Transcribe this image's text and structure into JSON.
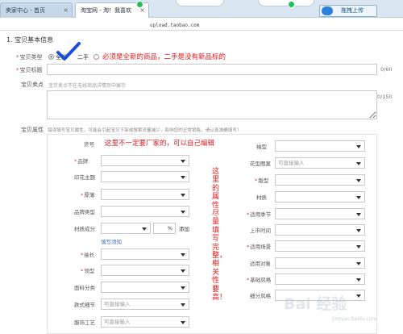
{
  "browser": {
    "tab1": "卖家中心 - 首页",
    "tab2": "淘宝网 - 淘！我喜欢",
    "tab_close": "×",
    "upload_button": "拖拽上传",
    "url": "upload.taobao.com"
  },
  "form": {
    "section_title": "1. 宝贝基本信息",
    "type_label": "宝贝类型",
    "type_options": [
      "全新",
      "二手"
    ],
    "type_selected": "全新",
    "title_label": "宝贝标题",
    "title_value": "",
    "title_counter": "0/60",
    "sellpoint_label": "宝贝卖点",
    "sellpoint_placeholder": "宝贝卖点不在无线商品详情页中展示",
    "sellpoint_counter": "0/150",
    "attr_label": "宝贝属性",
    "attr_hint": "错误填写宝贝属性，可能会引起宝贝下架或搜索流量减少，影响您的正常销售，请认真准确填写！",
    "required_mark": "*"
  },
  "annotations": {
    "type_note": "必须是全新的商品，二手是没有新品标的",
    "brand_note": "这里不一定要厂家的，可以自己编辑",
    "vertical_note": "这里的属性尽量填写完整，相关性要高！"
  },
  "attributes": {
    "left": [
      {
        "label": "货号",
        "required": false,
        "kind": "text",
        "value": ""
      },
      {
        "label": "品牌",
        "required": true,
        "kind": "select",
        "value": ""
      },
      {
        "label": "印花主题",
        "required": false,
        "kind": "select",
        "value": ""
      },
      {
        "label": "厚薄",
        "required": true,
        "kind": "select",
        "value": ""
      },
      {
        "label": "品牌类型",
        "required": false,
        "kind": "select",
        "value": ""
      },
      {
        "label": "材质成分",
        "required": false,
        "kind": "material",
        "value": ""
      },
      {
        "label": "袖长",
        "required": true,
        "kind": "select",
        "value": ""
      },
      {
        "label": "领型",
        "required": true,
        "kind": "select",
        "value": ""
      },
      {
        "label": "面料分类",
        "required": false,
        "kind": "select",
        "value": ""
      },
      {
        "label": "款式细节",
        "required": false,
        "kind": "select",
        "value": "可直接输入"
      },
      {
        "label": "服饰工艺",
        "required": false,
        "kind": "select",
        "value": "可直接输入"
      }
    ],
    "right": [
      {
        "label": "袖型",
        "required": false,
        "value": ""
      },
      {
        "label": "花型图案",
        "required": false,
        "value": "可直接输入"
      },
      {
        "label": "版型",
        "required": true,
        "value": ""
      },
      {
        "label": "材质",
        "required": false,
        "value": ""
      },
      {
        "label": "适用季节",
        "required": true,
        "value": ""
      },
      {
        "label": "上市时间",
        "required": false,
        "value": ""
      },
      {
        "label": "适用场景",
        "required": true,
        "value": ""
      },
      {
        "label": "适用对象",
        "required": false,
        "value": ""
      },
      {
        "label": "基础风格",
        "required": true,
        "value": ""
      },
      {
        "label": "细分风格",
        "required": false,
        "value": ""
      }
    ],
    "material_percent_sign": "%",
    "material_add": "添加",
    "fill_link": "填写须知"
  },
  "watermark": {
    "text": "Bai 经验",
    "url": "jingyan.baidu.com"
  },
  "colors": {
    "annotation_red": "#e0191e",
    "check_blue": "#1d4fd6",
    "link_blue": "#3a6fb5"
  }
}
